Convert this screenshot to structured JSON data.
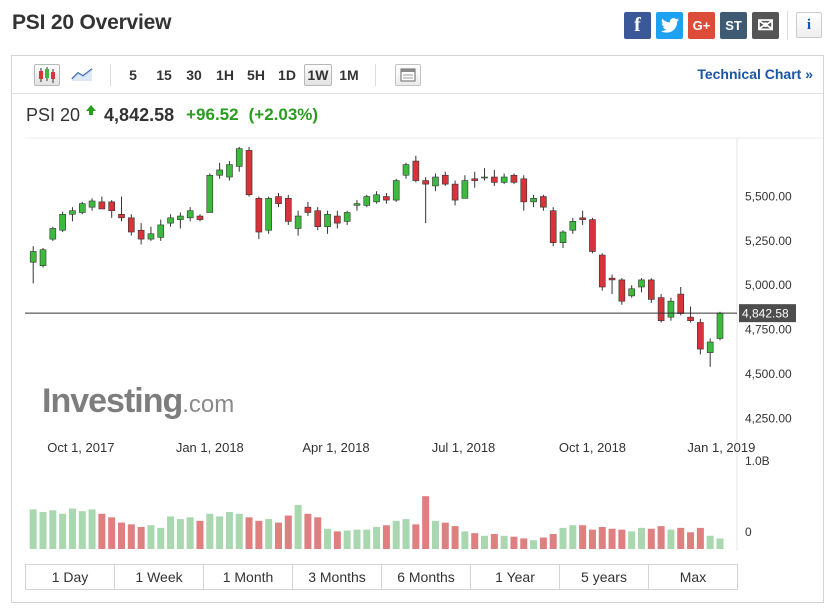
{
  "header": {
    "title": "PSI 20 Overview"
  },
  "social": [
    {
      "name": "facebook-icon",
      "glyph": "f",
      "color": "#3b5998"
    },
    {
      "name": "twitter-icon",
      "glyph": "t",
      "color": "#1da1f2"
    },
    {
      "name": "google-plus-icon",
      "glyph": "G+",
      "color": "#dd4b39"
    },
    {
      "name": "stocktwits-icon",
      "glyph": "ST",
      "color": "#3f5a73"
    },
    {
      "name": "email-icon",
      "glyph": "✉",
      "color": "#555555"
    }
  ],
  "info": {
    "glyph": "i"
  },
  "toolbar": {
    "timeframes": [
      "5",
      "15",
      "30",
      "1H",
      "5H",
      "1D",
      "1W",
      "1M"
    ],
    "active_timeframe": "1W",
    "technical_chart": "Technical Chart »"
  },
  "quote": {
    "name": "PSI 20",
    "last": "4,842.58",
    "change": "+96.52",
    "change_pct": "(+2.03%)"
  },
  "ranges": [
    "1 Day",
    "1 Week",
    "1 Month",
    "3 Months",
    "6 Months",
    "1 Year",
    "5 years",
    "Max"
  ],
  "colors": {
    "up": "#3dba3d",
    "down": "#d8323a",
    "vol_up": "#a9d7af",
    "vol_down": "#de7f80",
    "link": "#1a56a6"
  },
  "chart_data": {
    "type": "candlestick",
    "watermark": "Investing.com",
    "last_price_label": "4,842.58",
    "last_price": 4842.58,
    "y_ticks": [
      {
        "value": 5500,
        "label": "5,500.00"
      },
      {
        "value": 5250,
        "label": "5,250.00"
      },
      {
        "value": 5000,
        "label": "5,000.00"
      },
      {
        "value": 4750,
        "label": "4,750.00"
      },
      {
        "value": 4500,
        "label": "4,500.00"
      },
      {
        "value": 4250,
        "label": "4,250.00"
      }
    ],
    "x_ticks": [
      {
        "date": "2017-10-01",
        "label": "Oct 1, 2017"
      },
      {
        "date": "2018-01-01",
        "label": "Jan 1, 2018"
      },
      {
        "date": "2018-04-01",
        "label": "Apr 1, 2018"
      },
      {
        "date": "2018-07-01",
        "label": "Jul 1, 2018"
      },
      {
        "date": "2018-10-01",
        "label": "Oct 1, 2018"
      },
      {
        "date": "2019-01-01",
        "label": "Jan 1, 2019"
      }
    ],
    "x_range": [
      "2017-08-25",
      "2019-01-10"
    ],
    "volume_ticks": [
      {
        "label": "1.0B",
        "value": 1000000000
      },
      {
        "label": "0",
        "value": 0
      }
    ],
    "candles": [
      {
        "d": "2017-08-28",
        "o": 5130,
        "h": 5220,
        "l": 5010,
        "c": 5190
      },
      {
        "d": "2017-09-04",
        "o": 5110,
        "h": 5210,
        "l": 5100,
        "c": 5200
      },
      {
        "d": "2017-09-11",
        "o": 5260,
        "h": 5330,
        "l": 5250,
        "c": 5320
      },
      {
        "d": "2017-09-18",
        "o": 5310,
        "h": 5415,
        "l": 5300,
        "c": 5400
      },
      {
        "d": "2017-09-25",
        "o": 5400,
        "h": 5440,
        "l": 5360,
        "c": 5420
      },
      {
        "d": "2017-10-02",
        "o": 5410,
        "h": 5470,
        "l": 5400,
        "c": 5460
      },
      {
        "d": "2017-10-09",
        "o": 5440,
        "h": 5490,
        "l": 5420,
        "c": 5475
      },
      {
        "d": "2017-10-16",
        "o": 5470,
        "h": 5500,
        "l": 5450,
        "c": 5430
      },
      {
        "d": "2017-10-23",
        "o": 5470,
        "h": 5480,
        "l": 5380,
        "c": 5420
      },
      {
        "d": "2017-10-30",
        "o": 5400,
        "h": 5500,
        "l": 5360,
        "c": 5380
      },
      {
        "d": "2017-11-06",
        "o": 5380,
        "h": 5400,
        "l": 5280,
        "c": 5300
      },
      {
        "d": "2017-11-13",
        "o": 5310,
        "h": 5350,
        "l": 5230,
        "c": 5260
      },
      {
        "d": "2017-11-20",
        "o": 5260,
        "h": 5330,
        "l": 5250,
        "c": 5290
      },
      {
        "d": "2017-11-27",
        "o": 5270,
        "h": 5370,
        "l": 5250,
        "c": 5340
      },
      {
        "d": "2017-12-04",
        "o": 5350,
        "h": 5400,
        "l": 5330,
        "c": 5380
      },
      {
        "d": "2017-12-11",
        "o": 5370,
        "h": 5410,
        "l": 5320,
        "c": 5390
      },
      {
        "d": "2017-12-18",
        "o": 5380,
        "h": 5440,
        "l": 5360,
        "c": 5420
      },
      {
        "d": "2017-12-25",
        "o": 5390,
        "h": 5400,
        "l": 5360,
        "c": 5370
      },
      {
        "d": "2018-01-01",
        "o": 5410,
        "h": 5630,
        "l": 5410,
        "c": 5620
      },
      {
        "d": "2018-01-08",
        "o": 5620,
        "h": 5690,
        "l": 5600,
        "c": 5650
      },
      {
        "d": "2018-01-15",
        "o": 5610,
        "h": 5700,
        "l": 5590,
        "c": 5680
      },
      {
        "d": "2018-01-22",
        "o": 5670,
        "h": 5780,
        "l": 5640,
        "c": 5770
      },
      {
        "d": "2018-01-29",
        "o": 5760,
        "h": 5780,
        "l": 5500,
        "c": 5510
      },
      {
        "d": "2018-02-05",
        "o": 5490,
        "h": 5500,
        "l": 5260,
        "c": 5300
      },
      {
        "d": "2018-02-12",
        "o": 5310,
        "h": 5500,
        "l": 5290,
        "c": 5490
      },
      {
        "d": "2018-02-19",
        "o": 5500,
        "h": 5520,
        "l": 5440,
        "c": 5460
      },
      {
        "d": "2018-02-26",
        "o": 5490,
        "h": 5510,
        "l": 5340,
        "c": 5360
      },
      {
        "d": "2018-03-05",
        "o": 5320,
        "h": 5420,
        "l": 5280,
        "c": 5390
      },
      {
        "d": "2018-03-12",
        "o": 5440,
        "h": 5470,
        "l": 5390,
        "c": 5410
      },
      {
        "d": "2018-03-19",
        "o": 5420,
        "h": 5440,
        "l": 5310,
        "c": 5330
      },
      {
        "d": "2018-03-26",
        "o": 5330,
        "h": 5420,
        "l": 5290,
        "c": 5400
      },
      {
        "d": "2018-04-02",
        "o": 5390,
        "h": 5420,
        "l": 5320,
        "c": 5350
      },
      {
        "d": "2018-04-09",
        "o": 5360,
        "h": 5420,
        "l": 5340,
        "c": 5410
      },
      {
        "d": "2018-04-16",
        "o": 5450,
        "h": 5480,
        "l": 5420,
        "c": 5460
      },
      {
        "d": "2018-04-23",
        "o": 5450,
        "h": 5510,
        "l": 5440,
        "c": 5500
      },
      {
        "d": "2018-04-30",
        "o": 5470,
        "h": 5530,
        "l": 5460,
        "c": 5510
      },
      {
        "d": "2018-05-07",
        "o": 5500,
        "h": 5520,
        "l": 5460,
        "c": 5480
      },
      {
        "d": "2018-05-14",
        "o": 5480,
        "h": 5600,
        "l": 5470,
        "c": 5590
      },
      {
        "d": "2018-05-21",
        "o": 5620,
        "h": 5690,
        "l": 5600,
        "c": 5680
      },
      {
        "d": "2018-05-28",
        "o": 5700,
        "h": 5730,
        "l": 5580,
        "c": 5590
      },
      {
        "d": "2018-06-04",
        "o": 5590,
        "h": 5610,
        "l": 5350,
        "c": 5570
      },
      {
        "d": "2018-06-11",
        "o": 5560,
        "h": 5630,
        "l": 5530,
        "c": 5610
      },
      {
        "d": "2018-06-18",
        "o": 5620,
        "h": 5640,
        "l": 5560,
        "c": 5570
      },
      {
        "d": "2018-06-25",
        "o": 5570,
        "h": 5590,
        "l": 5450,
        "c": 5480
      },
      {
        "d": "2018-07-02",
        "o": 5490,
        "h": 5620,
        "l": 5490,
        "c": 5590
      },
      {
        "d": "2018-07-09",
        "o": 5600,
        "h": 5640,
        "l": 5550,
        "c": 5590
      },
      {
        "d": "2018-07-16",
        "o": 5610,
        "h": 5660,
        "l": 5590,
        "c": 5610
      },
      {
        "d": "2018-07-23",
        "o": 5610,
        "h": 5650,
        "l": 5560,
        "c": 5580
      },
      {
        "d": "2018-07-30",
        "o": 5580,
        "h": 5630,
        "l": 5570,
        "c": 5610
      },
      {
        "d": "2018-08-06",
        "o": 5620,
        "h": 5630,
        "l": 5570,
        "c": 5580
      },
      {
        "d": "2018-08-13",
        "o": 5600,
        "h": 5620,
        "l": 5420,
        "c": 5470
      },
      {
        "d": "2018-08-20",
        "o": 5470,
        "h": 5510,
        "l": 5440,
        "c": 5490
      },
      {
        "d": "2018-08-27",
        "o": 5500,
        "h": 5510,
        "l": 5420,
        "c": 5440
      },
      {
        "d": "2018-09-03",
        "o": 5420,
        "h": 5440,
        "l": 5220,
        "c": 5240
      },
      {
        "d": "2018-09-10",
        "o": 5240,
        "h": 5310,
        "l": 5210,
        "c": 5300
      },
      {
        "d": "2018-09-17",
        "o": 5310,
        "h": 5380,
        "l": 5290,
        "c": 5360
      },
      {
        "d": "2018-09-24",
        "o": 5380,
        "h": 5420,
        "l": 5340,
        "c": 5370
      },
      {
        "d": "2018-10-01",
        "o": 5370,
        "h": 5380,
        "l": 5180,
        "c": 5190
      },
      {
        "d": "2018-10-08",
        "o": 5170,
        "h": 5180,
        "l": 4970,
        "c": 4990
      },
      {
        "d": "2018-10-15",
        "o": 5040,
        "h": 5060,
        "l": 4950,
        "c": 5030
      },
      {
        "d": "2018-10-22",
        "o": 5030,
        "h": 5040,
        "l": 4890,
        "c": 4910
      },
      {
        "d": "2018-10-29",
        "o": 4940,
        "h": 5000,
        "l": 4930,
        "c": 4980
      },
      {
        "d": "2018-11-05",
        "o": 4990,
        "h": 5040,
        "l": 4960,
        "c": 5030
      },
      {
        "d": "2018-11-12",
        "o": 5030,
        "h": 5040,
        "l": 4900,
        "c": 4920
      },
      {
        "d": "2018-11-19",
        "o": 4930,
        "h": 4950,
        "l": 4790,
        "c": 4800
      },
      {
        "d": "2018-11-26",
        "o": 4820,
        "h": 4930,
        "l": 4800,
        "c": 4910
      },
      {
        "d": "2018-12-03",
        "o": 4950,
        "h": 4990,
        "l": 4830,
        "c": 4840
      },
      {
        "d": "2018-12-10",
        "o": 4820,
        "h": 4880,
        "l": 4790,
        "c": 4800
      },
      {
        "d": "2018-12-17",
        "o": 4790,
        "h": 4810,
        "l": 4610,
        "c": 4640
      },
      {
        "d": "2018-12-24",
        "o": 4620,
        "h": 4700,
        "l": 4540,
        "c": 4680
      },
      {
        "d": "2018-12-31",
        "o": 4700,
        "h": 4850,
        "l": 4690,
        "c": 4842.58
      }
    ],
    "volume_relative": [
      0.45,
      0.42,
      0.44,
      0.4,
      0.46,
      0.43,
      0.45,
      0.4,
      0.36,
      0.3,
      0.28,
      0.25,
      0.27,
      0.24,
      0.37,
      0.34,
      0.36,
      0.32,
      0.4,
      0.37,
      0.42,
      0.4,
      0.36,
      0.32,
      0.34,
      0.3,
      0.38,
      0.5,
      0.4,
      0.36,
      0.23,
      0.2,
      0.21,
      0.22,
      0.22,
      0.25,
      0.27,
      0.32,
      0.34,
      0.28,
      0.6,
      0.32,
      0.3,
      0.26,
      0.2,
      0.18,
      0.15,
      0.17,
      0.15,
      0.14,
      0.12,
      0.1,
      0.13,
      0.17,
      0.24,
      0.27,
      0.27,
      0.22,
      0.25,
      0.23,
      0.22,
      0.2,
      0.24,
      0.23,
      0.26,
      0.22,
      0.24,
      0.19,
      0.24,
      0.15,
      0.12
    ]
  }
}
